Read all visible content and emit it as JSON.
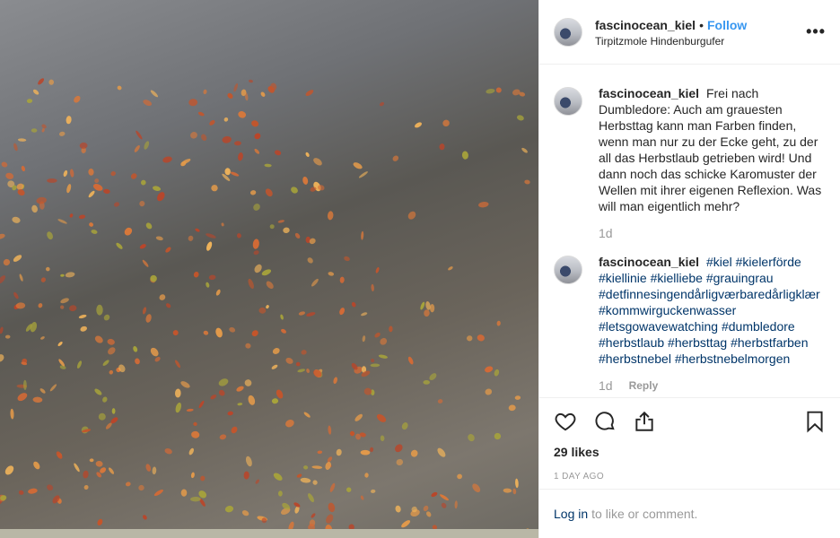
{
  "header": {
    "username": "fascinocean_kiel",
    "separator": "•",
    "follow_label": "Follow",
    "location": "Tirpitzmole Hindenburgufer",
    "more_label": "•••"
  },
  "comments": [
    {
      "username": "fascinocean_kiel",
      "text": "Frei nach Dumbledore: Auch am grauesten Herbsttag kann man Farben finden, wenn man nur zu der Ecke geht, zu der all das Herbstlaub getrieben wird! Und dann noch das schicke Karomuster der Wellen mit ihrer eigenen Reflexion. Was will man eigentlich mehr?",
      "time": "1d"
    },
    {
      "username": "fascinocean_kiel",
      "text": "#kiel #kielerförde #kiellinie #kielliebe #grauingrau #detfinnesingendårligværbaredårligklær #kommwirguckenwasser #letsgowavewatching #dumbledore #herbstlaub #herbsttag #herbstfarben #herbstnebel #herbstnebelmorgen",
      "time": "1d",
      "reply_label": "Reply"
    }
  ],
  "actions": {
    "likes": "29 likes",
    "date": "1 DAY AGO"
  },
  "login": {
    "link_label": "Log in",
    "rest": "to like or comment."
  },
  "icons": [
    "heart-icon",
    "comment-icon",
    "share-icon",
    "bookmark-icon",
    "more-icon"
  ],
  "colors": {
    "link_blue": "#3897f0",
    "hashtag": "#003569",
    "muted": "#999999"
  }
}
